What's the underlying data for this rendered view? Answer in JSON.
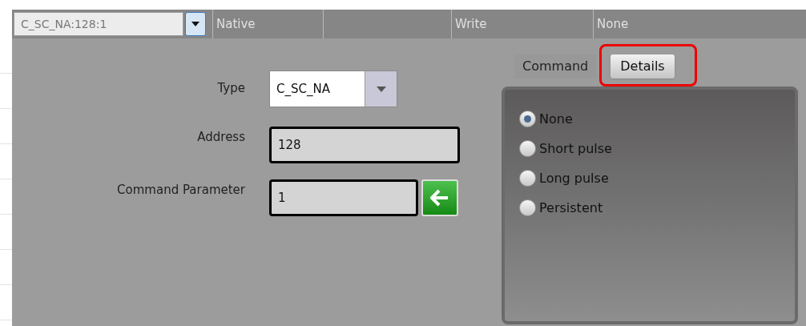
{
  "header_row": {
    "combo": {
      "value": "C_SC_NA:128:1"
    },
    "cells": [
      "Native",
      "",
      "Write",
      "None"
    ]
  },
  "form": {
    "type": {
      "label": "Type",
      "value": "C_SC_NA"
    },
    "address": {
      "label": "Address",
      "value": "128"
    },
    "command_parameter": {
      "label": "Command Parameter",
      "value": "1"
    }
  },
  "tabs": [
    {
      "label": "Command",
      "selected": true
    },
    {
      "label": "Details",
      "selected": false,
      "highlighted": true
    }
  ],
  "options": [
    {
      "label": "None",
      "selected": true
    },
    {
      "label": "Short pulse",
      "selected": false
    },
    {
      "label": "Long pulse",
      "selected": false
    },
    {
      "label": "Persistent",
      "selected": false
    }
  ]
}
